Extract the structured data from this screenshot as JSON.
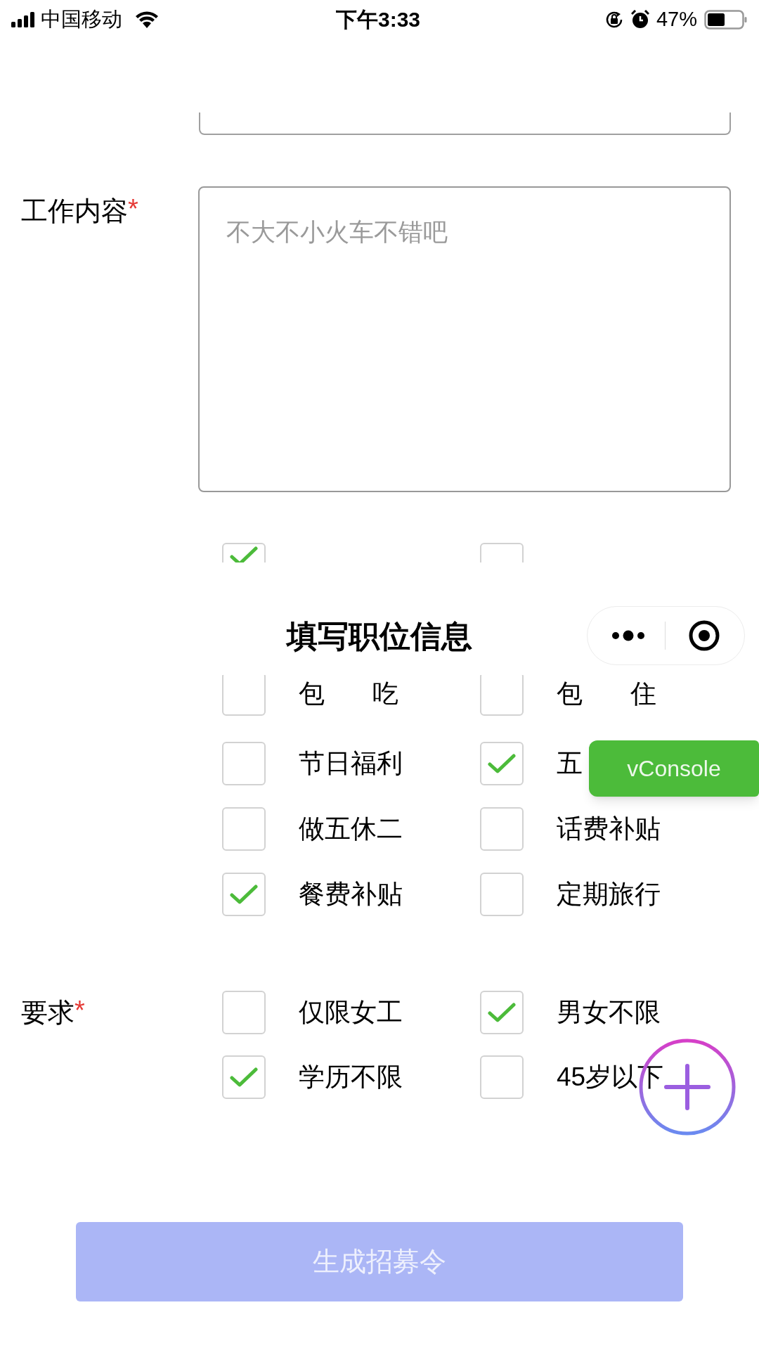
{
  "status_bar": {
    "carrier": "中国移动",
    "time": "下午3:33",
    "battery": "47%"
  },
  "job_content": {
    "label": "工作内容",
    "required_mark": "*",
    "placeholder": "不大不小火车不错吧"
  },
  "benefits_clipped": {
    "options": [
      {
        "checked": true
      },
      {
        "checked": false
      }
    ]
  },
  "nav_bar": {
    "title": "填写职位信息"
  },
  "benefits": [
    {
      "label": "包 吃",
      "checked": false
    },
    {
      "label": "包 住",
      "checked": false
    },
    {
      "label": "节日福利",
      "checked": false
    },
    {
      "label": "五",
      "checked": true
    },
    {
      "label": "做五休二",
      "checked": false
    },
    {
      "label": "话费补贴",
      "checked": false
    },
    {
      "label": "餐费补贴",
      "checked": true
    },
    {
      "label": "定期旅行",
      "checked": false
    }
  ],
  "requirements": {
    "label": "要求",
    "required_mark": "*",
    "options": [
      {
        "label": "仅限女工",
        "checked": false
      },
      {
        "label": "男女不限",
        "checked": true
      },
      {
        "label": "学历不限",
        "checked": true
      },
      {
        "label": "45岁以下",
        "checked": false
      }
    ]
  },
  "vconsole_button": "vConsole",
  "submit_button": {
    "label": "生成招募令",
    "disabled": true
  }
}
